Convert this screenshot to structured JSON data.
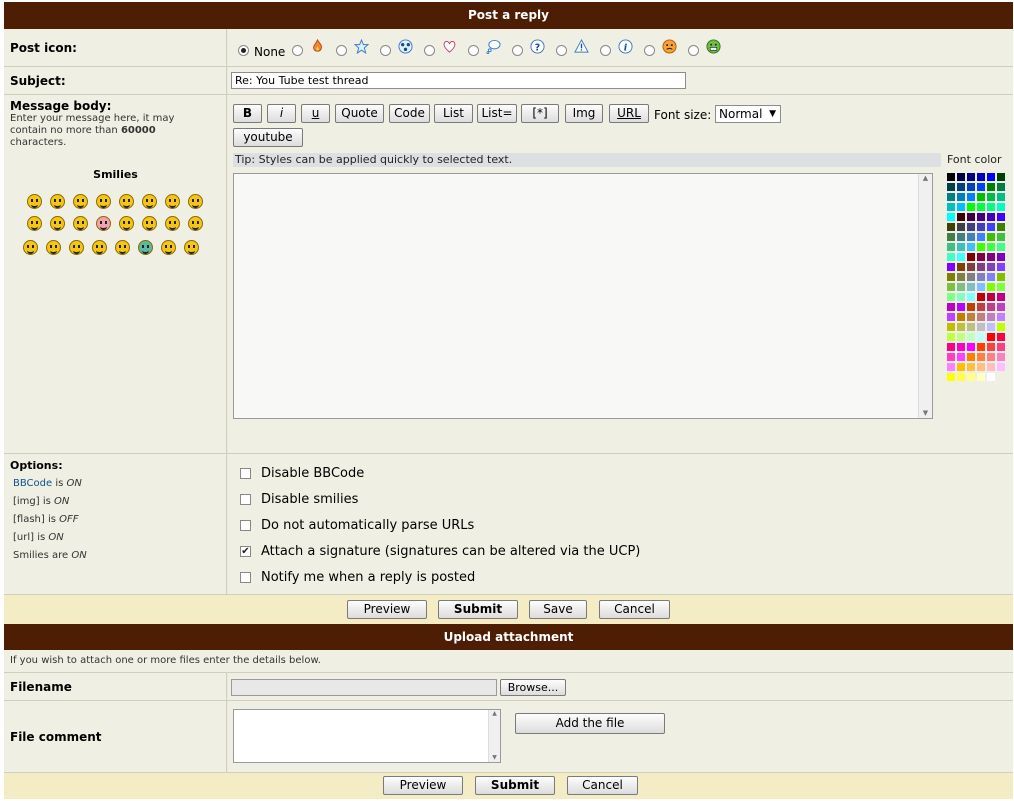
{
  "post": {
    "title": "Post a reply",
    "icon_label": "Post icon:",
    "icon_none": "None",
    "icons": [
      "fire-icon",
      "star-icon",
      "radioactive-icon",
      "heart-icon",
      "speech-bubble-icon",
      "question-icon",
      "warning-icon",
      "info-icon",
      "sad-face-icon",
      "grin-face-icon"
    ],
    "subject_label": "Subject:",
    "subject_value": "Re: You Tube test thread",
    "body_label": "Message body:",
    "body_desc_1": "Enter your message here, it may",
    "body_desc_2": "contain no more than",
    "body_desc_max": "60000",
    "body_desc_3": "characters.",
    "smilies_label": "Smilies",
    "toolbar": {
      "bold": "B",
      "italic": "i",
      "underline": "u",
      "quote": "Quote",
      "code": "Code",
      "list": "List",
      "list_eq": "List=",
      "star": "[*]",
      "img": "Img",
      "url": "URL",
      "youtube": "youtube",
      "font_size_label": "Font size:",
      "font_size_value": "Normal"
    },
    "tip": "Tip: Styles can be applied quickly to selected text.",
    "font_color_label": "Font color",
    "options_label": "Options:",
    "status": {
      "bbcode_link": "BBCode",
      "bbcode_is": "is",
      "bbcode_state": "ON",
      "img": "[img] is",
      "img_state": "ON",
      "flash": "[flash] is",
      "flash_state": "OFF",
      "url": "[url] is",
      "url_state": "ON",
      "smilies": "Smilies are",
      "smilies_state": "ON"
    },
    "options": [
      {
        "label": "Disable BBCode",
        "checked": false
      },
      {
        "label": "Disable smilies",
        "checked": false
      },
      {
        "label": "Do not automatically parse URLs",
        "checked": false
      },
      {
        "label": "Attach a signature (signatures can be altered via the UCP)",
        "checked": true
      },
      {
        "label": "Notify me when a reply is posted",
        "checked": false
      }
    ],
    "buttons": {
      "preview": "Preview",
      "submit": "Submit",
      "save": "Save",
      "cancel": "Cancel"
    }
  },
  "upload": {
    "title": "Upload attachment",
    "intro": "If you wish to attach one or more files enter the details below.",
    "filename_label": "Filename",
    "browse": "Browse...",
    "comment_label": "File comment",
    "add_file": "Add the file",
    "buttons": {
      "preview": "Preview",
      "submit": "Submit",
      "cancel": "Cancel"
    }
  },
  "colors": {
    "header_bg": "#4d1d04",
    "panel_bg": "#efefe4",
    "button_bar_bg": "#f3ecc4",
    "link": "#105289"
  }
}
